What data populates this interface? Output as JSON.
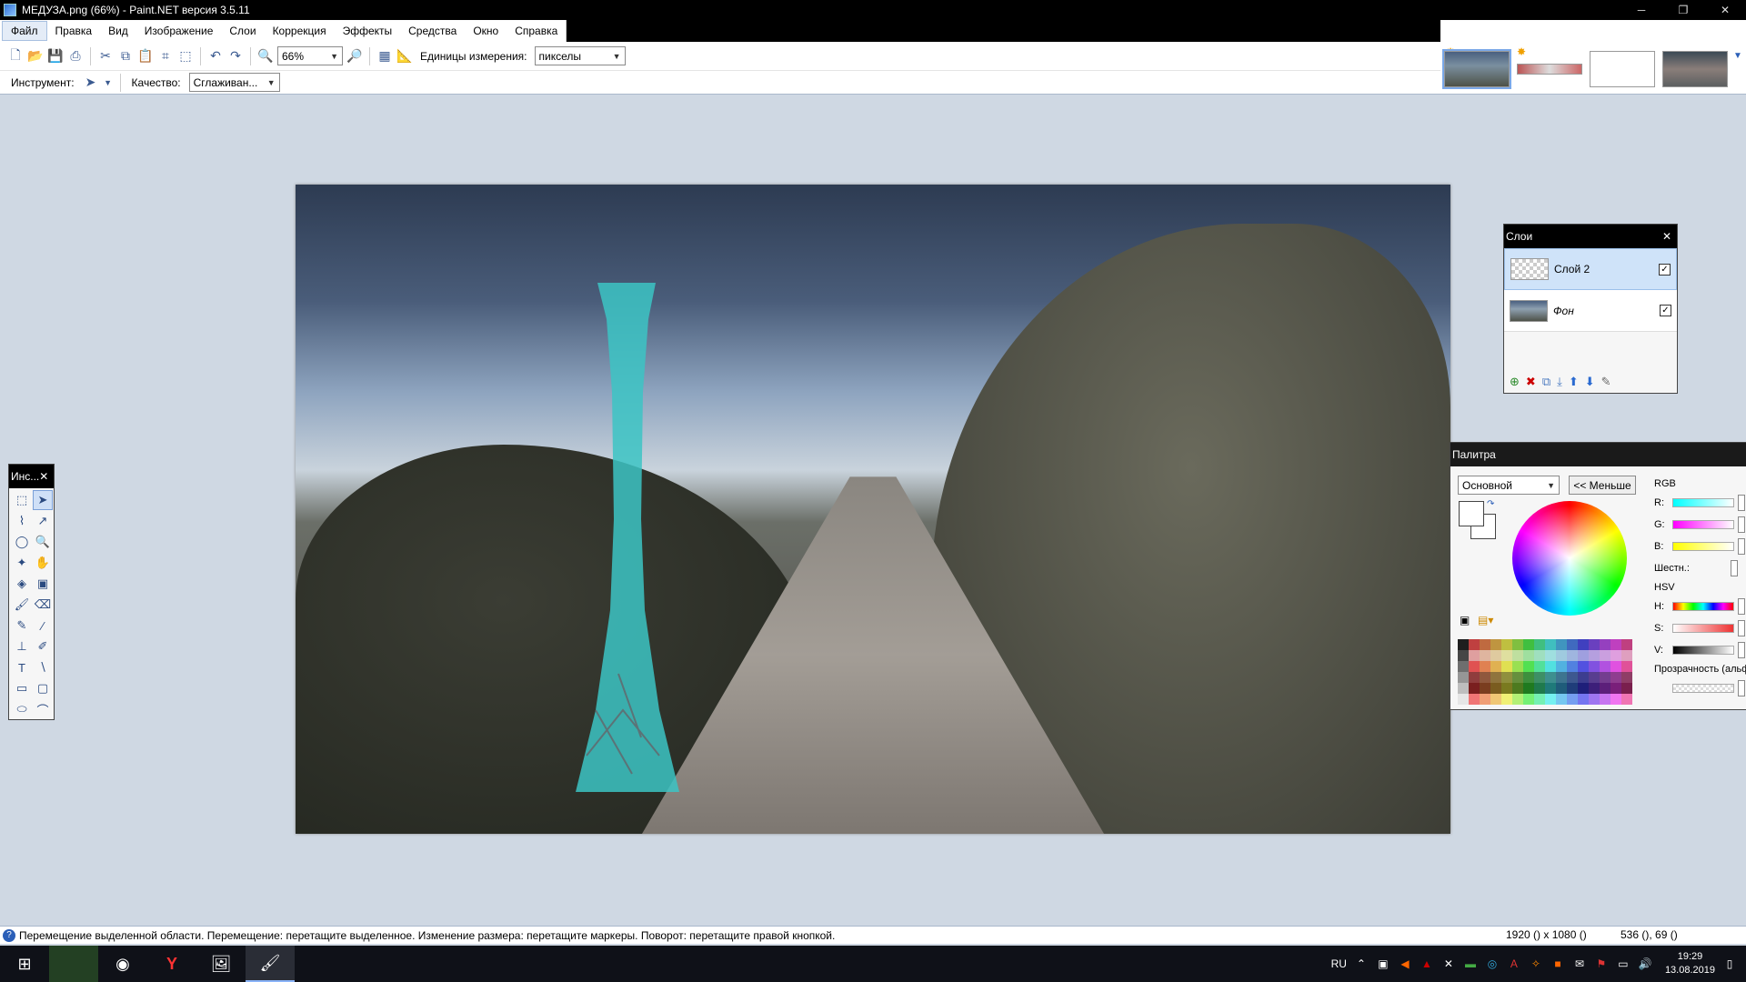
{
  "window": {
    "title": "МЕДУЗА.png (66%) - Paint.NET версия 3.5.11",
    "minimize_icon": "minimize-icon",
    "restore_icon": "restore-icon",
    "close_icon": "close-icon"
  },
  "menu": [
    {
      "label": "Файл"
    },
    {
      "label": "Правка"
    },
    {
      "label": "Вид"
    },
    {
      "label": "Изображение"
    },
    {
      "label": "Слои"
    },
    {
      "label": "Коррекция"
    },
    {
      "label": "Эффекты"
    },
    {
      "label": "Средства"
    },
    {
      "label": "Окно"
    },
    {
      "label": "Справка"
    }
  ],
  "toolbar": {
    "zoom_value": "66%",
    "units_label": "Единицы измерения:",
    "units_value": "пикселы"
  },
  "toolbar2": {
    "tool_label": "Инструмент:",
    "quality_label": "Качество:",
    "quality_value": "Сглаживан..."
  },
  "tools_panel": {
    "title": "Инс..."
  },
  "layers_panel": {
    "title": "Слои",
    "layers": [
      {
        "name": "Слой 2",
        "visible": "✓"
      },
      {
        "name": "Фон",
        "visible": "✓"
      }
    ]
  },
  "palette_panel": {
    "title": "Палитра",
    "mode_value": "Основной",
    "less_button": "<< Меньше",
    "rgb_label": "RGB",
    "r_label": "R:",
    "g_label": "G:",
    "b_label": "B:",
    "hex_label": "Шестн.:",
    "hsv_label": "HSV",
    "h_label": "H:",
    "s_label": "S:",
    "v_label": "V:",
    "alpha_label": "Прозрачность (альф"
  },
  "status": {
    "message": "Перемещение выделенной области. Перемещение: перетащите выделенное. Изменение размера: перетащите маркеры. Поворот: перетащите правой кнопкой.",
    "image_size": "1920 () x 1080 ()",
    "cursor": "536 (), 69 ()"
  },
  "taskbar": {
    "language": "RU",
    "time": "19:29",
    "date": "13.08.2019"
  },
  "colors": {
    "accent": "#7aa8e8",
    "vase": "#3cc4c4",
    "selection": "#cfe3f9"
  }
}
